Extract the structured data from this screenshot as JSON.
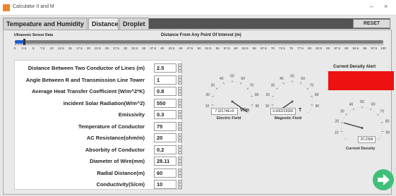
{
  "window": {
    "title": "Calculator II and M",
    "minimize": "–",
    "close": "×"
  },
  "tabs": [
    {
      "label": "Tempeature and Humidity",
      "active": false
    },
    {
      "label": "Distance",
      "active": true
    },
    {
      "label": "Droplet",
      "active": false
    }
  ],
  "reset_label": "RESET",
  "sensor_label": "Ultrasonic Sensor Data",
  "slider": {
    "title": "Distance From Any Point Of Interest (m)",
    "min": 0,
    "max": 100,
    "value": 2.5,
    "ticks": [
      "0",
      "2.5",
      "5",
      "7.5",
      "10",
      "12.5",
      "15",
      "17.5",
      "20",
      "22.5",
      "25",
      "27.5",
      "30",
      "32.5",
      "35",
      "37.5",
      "40",
      "42.5",
      "45",
      "47.5",
      "50",
      "52.5",
      "55",
      "57.5",
      "60",
      "62.5",
      "65",
      "67.5",
      "70",
      "72.5",
      "75",
      "77.5",
      "80",
      "82.5",
      "85",
      "87.5",
      "90",
      "92.5",
      "95",
      "97.5",
      "100"
    ],
    "fill_color": "#1f5ccc"
  },
  "params": [
    {
      "label": "Distance Between Two Conductor of Lines (m)",
      "value": "2.5"
    },
    {
      "label": "Angle Between R and Transmission Line Tower",
      "value": "1"
    },
    {
      "label": "Average Heat Transfer Coefficient (W/m^2*K)",
      "value": "0.8"
    },
    {
      "label": "Incident Solar Radiation(W/m^2)",
      "value": "550"
    },
    {
      "label": "Emissivity",
      "value": "0.3"
    },
    {
      "label": "Temperature of Conductor",
      "value": "75"
    },
    {
      "label": "AC Resistance(ohm/m)",
      "value": "20"
    },
    {
      "label": "Absorbity of Conductor",
      "value": "0.2"
    },
    {
      "label": "Diameter of Wire(mm)",
      "value": "28.11"
    },
    {
      "label": "Radial Distance(m)",
      "value": "60"
    },
    {
      "label": "Conductivity(S/cm)",
      "value": "10"
    }
  ],
  "gauges": {
    "electric": {
      "value": "7.32174E+9",
      "unit": "V/m",
      "caption": "Electric Field",
      "needle": 100,
      "tick_labels": [
        "0",
        "10",
        "20",
        "30",
        "40",
        "50",
        "60",
        "70",
        "80",
        "90",
        "100"
      ]
    },
    "magnetic": {
      "value": "0.000215992",
      "unit": "T",
      "caption": "Magnetic Field",
      "needle": 0,
      "tick_labels": [
        "0",
        "10",
        "20",
        "30",
        "40",
        "50",
        "60",
        "70",
        "80",
        "90",
        "100"
      ]
    },
    "current": {
      "value": "20.2368",
      "caption": "Current Density",
      "needle": 20.2368,
      "tick_labels": [
        "0",
        "10",
        "20",
        "30",
        "40",
        "50",
        "60",
        "70",
        "80",
        "90",
        "100"
      ]
    }
  },
  "alert": {
    "title": "Current Density Alert",
    "color": "#ee1111"
  },
  "icons": {
    "next": "arrow-right-circle-icon",
    "app": "app-icon"
  },
  "next_color": "#3fbf7a"
}
